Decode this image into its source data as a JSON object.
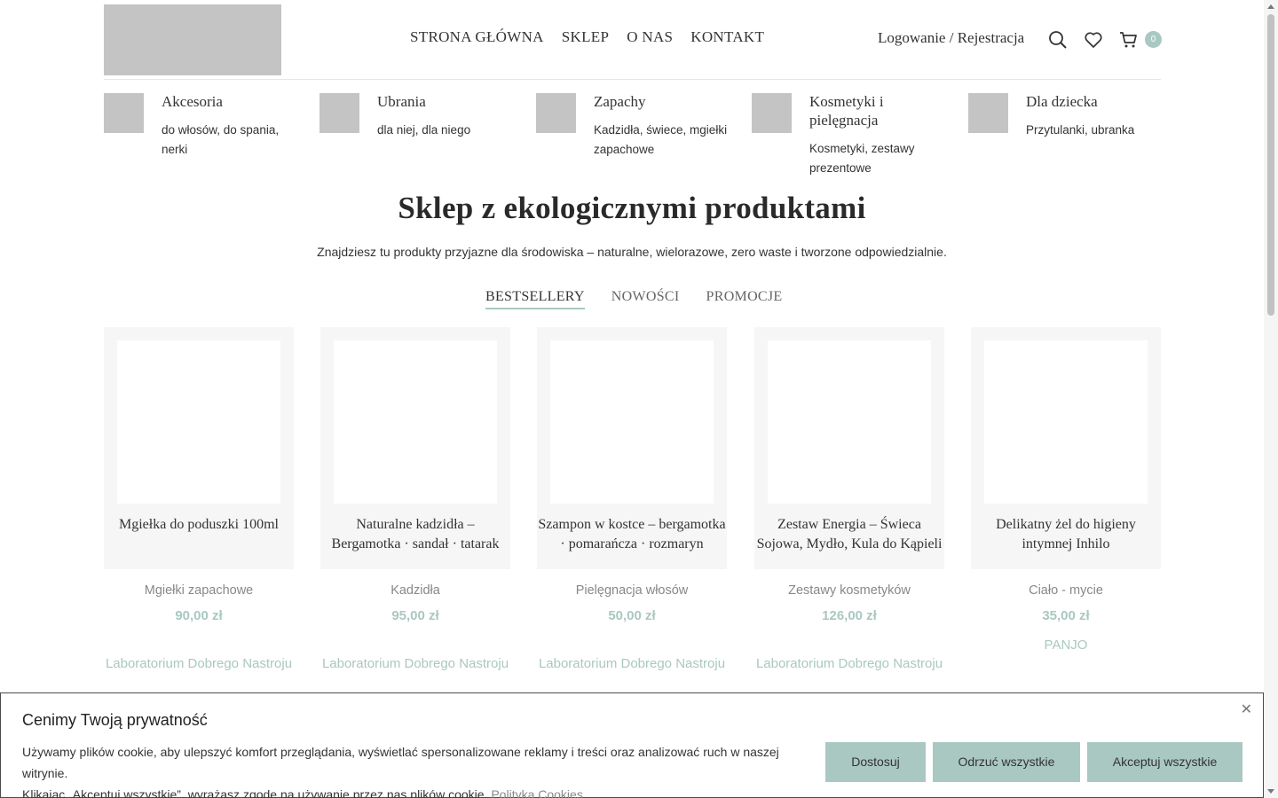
{
  "header": {
    "nav": [
      "STRONA GŁÓWNA",
      "SKLEP",
      "O NAS",
      "KONTAKT"
    ],
    "login": "Logowanie / Rejestracja",
    "cart_count": "0",
    "icons": [
      "search-icon",
      "heart-icon",
      "cart-icon"
    ]
  },
  "categories": [
    {
      "title": "Akcesoria",
      "desc": "do włosów, do spania, nerki"
    },
    {
      "title": "Ubrania",
      "desc": "dla niej, dla niego"
    },
    {
      "title": "Zapachy",
      "desc": "Kadzidła, świece, mgiełki zapachowe"
    },
    {
      "title": "Kosmetyki i pielęgnacja",
      "desc": "Kosmetyki, zestawy prezentowe"
    },
    {
      "title": "Dla dziecka",
      "desc": "Przytulanki, ubranka"
    }
  ],
  "hero": {
    "title": "Sklep z ekologicznymi produktami",
    "subtitle": "Znajdziesz tu produkty przyjazne dla środowiska – naturalne, wielorazowe, zero waste i tworzone odpowiedzialnie."
  },
  "tabs": [
    "BESTSELLERY",
    "NOWOŚCI",
    "PROMOCJE"
  ],
  "products": [
    {
      "name": "Mgiełka do poduszki 100ml",
      "category": "Mgiełki zapachowe",
      "price": "90,00 zł",
      "brand": "Laboratorium Dobrego Nastroju"
    },
    {
      "name": "Naturalne kadzidła – Bergamotka · sandał · tatarak",
      "category": "Kadzidła",
      "price": "95,00 zł",
      "brand": "Laboratorium Dobrego Nastroju"
    },
    {
      "name": "Szampon w kostce – bergamotka · pomarańcza · rozmaryn",
      "category": "Pielęgnacja włosów",
      "price": "50,00 zł",
      "brand": "Laboratorium Dobrego Nastroju"
    },
    {
      "name": "Zestaw Energia – Świeca Sojowa, Mydło, Kula do Kąpieli",
      "category": "Zestawy kosmetyków",
      "price": "126,00 zł",
      "brand": "Laboratorium Dobrego Nastroju"
    },
    {
      "name": "Delikatny żel do higieny intymnej Inhilo",
      "category": "Ciało - mycie",
      "price": "35,00 zł",
      "brand": "PANJO"
    }
  ],
  "cookie": {
    "title": "Cenimy Twoją prywatność",
    "text_line1": "Używamy plików cookie, aby ulepszyć komfort przeglądania, wyświetlać spersonalizowane reklamy i treści oraz analizować ruch w naszej witrynie.",
    "text_line2": "Klikając „Akceptuj wszystkie”, wyrażasz zgodę na używanie przez nas plików cookie.",
    "link": "Polityka Cookies",
    "close": "✕",
    "buttons": [
      "Dostosuj",
      "Odrzuć wszystkie",
      "Akceptuj wszystkie"
    ]
  },
  "colors": {
    "accent": "#a9c8c1",
    "placeholder": "#c4c4c4",
    "card_bg": "#f6f6f6"
  }
}
